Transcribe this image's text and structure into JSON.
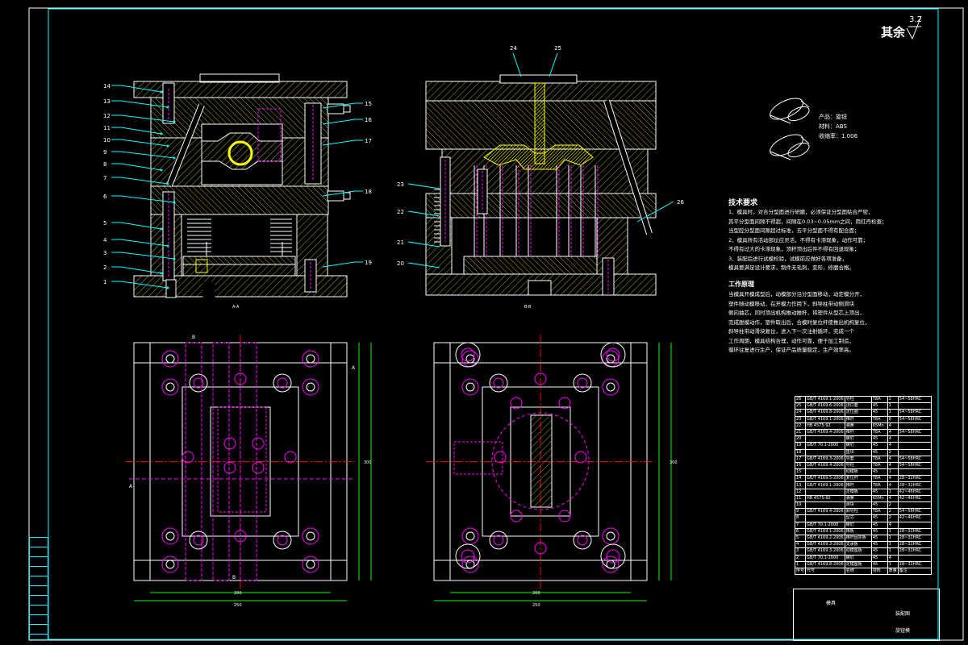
{
  "roughness": {
    "label": "其余",
    "value": "3.2"
  },
  "product": {
    "name": "产品：旋钮",
    "material": "材料：ABS",
    "shrink": "收缩率：1.006"
  },
  "tech": {
    "title": "技术要求",
    "lines": [
      "1、模具时，对合分型面进行研磨，必须保证分型面贴合严密，",
      "   其平分型面间隙不得超，间隙在0.03~0.05mm之间，用红丹检查；",
      "   当型腔分型面间隙超过标准，去平分型面不得有配合面；",
      "2、模具所有活动部位应灵活，不得有卡滞现象，动作可靠；",
      "   不得有过大的卡滞现象，顶杆顶出后件不得有回退现象；",
      "3、装配后进行试模检验，试模前应做好各项准备，",
      "   模具要满足设计要求，制件无毛刺，变形，修磨合格。"
    ]
  },
  "work": {
    "title": "工作原理",
    "lines": [
      "当模具开模成型后，动模部分沿分型面移动，动定模分开，",
      "塑件随动模移动，在开模力作用下，斜导柱带动侧滑块",
      "侧向抽芯，同时顶出机构推动推杆，将塑件从型芯上顶出，",
      "完成脱模动作，塑件取出后，合模时复位杆使推出机构复位，",
      "斜导柱带动滑块复位，进入下一次注射循环，完成一个",
      "工作周期，模具结构合理，动作可靠，便于加工制造，",
      "循环往复进行生产，保证产品质量稳定，生产效率高。"
    ]
  },
  "views": {
    "left": "A-A",
    "right": "B-B"
  },
  "balloons": {
    "left": [
      "14",
      "13",
      "12",
      "11",
      "10",
      "9",
      "8",
      "7",
      "6",
      "5",
      "4",
      "3",
      "2",
      "1"
    ],
    "leftRight": [
      "15",
      "16",
      "17",
      "18",
      "19"
    ],
    "rightTop": [
      "24",
      "25"
    ],
    "rightLeft": [
      "23",
      "22",
      "21",
      "20"
    ],
    "rightRight": [
      "26"
    ]
  },
  "bom": [
    [
      "26",
      "GB/T 4169.1-2006",
      "导柱",
      "T8A",
      "2",
      "54~58HRC"
    ],
    [
      "25",
      "GB/T 4169.6-2006",
      "浇口套",
      "45",
      "1",
      ""
    ],
    [
      "24",
      "GB/T 4169.8-2006",
      "定位圈",
      "45",
      "1",
      "54~58HRC"
    ],
    [
      "23",
      "GB/T 4169.1-2006",
      "推杆",
      "T8A",
      "8",
      "54~58HRC"
    ],
    [
      "22",
      "HB 4575-92",
      "弹簧",
      "65Mn",
      "4",
      ""
    ],
    [
      "21",
      "GB/T 4169.4-2006",
      "推杆",
      "T8A",
      "4",
      "54~58HRC"
    ],
    [
      "20",
      "",
      "螺钉",
      "45",
      "4",
      ""
    ],
    [
      "19",
      "GB/T 70.1-2000",
      "螺钉",
      "45",
      "4",
      ""
    ],
    [
      "18",
      "",
      "垫块",
      "45",
      "2",
      ""
    ],
    [
      "17",
      "GB/T 4169.3-2006",
      "导套",
      "T8A",
      "4",
      "54~58HRC"
    ],
    [
      "16",
      "GB/T 4169.4-2006",
      "导柱",
      "T8A",
      "4",
      "54~58HRC"
    ],
    [
      "15",
      "",
      "动模板",
      "45",
      "1",
      ""
    ],
    [
      "14",
      "GB/T 4169.5-2006",
      "复位杆",
      "T8A",
      "4",
      "28~32HRC"
    ],
    [
      "13",
      "GB/T 4169.1-2006",
      "推杆",
      "T8A",
      "4",
      "28~32HRC"
    ],
    [
      "12",
      "",
      "定模板",
      "45",
      "1",
      "42~46HRC"
    ],
    [
      "11",
      "HB 4575-92",
      "弹簧",
      "65Mn",
      "4",
      "42~46HRC"
    ],
    [
      "10",
      "",
      "滑块",
      "45",
      "2",
      ""
    ],
    [
      "9",
      "GB/T 4169.4-2006",
      "斜导柱",
      "T8A",
      "2",
      "54~58HRC"
    ],
    [
      "8",
      "",
      "型芯",
      "45",
      "2",
      "42~46HRC"
    ],
    [
      "7",
      "GB/T 70.1-2000",
      "螺钉",
      "45",
      "4",
      ""
    ],
    [
      "6",
      "GB/T 4169.1-2006",
      "推板",
      "45",
      "1",
      "28~32HRC"
    ],
    [
      "5",
      "GB/T 4169.2-2006",
      "推杆固定板",
      "45",
      "1",
      "28~32HRC"
    ],
    [
      "4",
      "GB/T 4169.3-2006",
      "支承板",
      "45",
      "1",
      "28~32HRC"
    ],
    [
      "3",
      "GB/T 4169.3-2006",
      "动模座板",
      "45",
      "1",
      "28~32HRC"
    ],
    [
      "2",
      "GB/T 70.1-2000",
      "螺钉",
      "45",
      "4",
      ""
    ],
    [
      "1",
      "GB/T 4169.8-2006",
      "定模座板",
      "45",
      "1",
      "28~32HRC"
    ]
  ],
  "bomHeader": [
    "序号",
    "代号",
    "名称",
    "材料",
    "数量",
    "备注"
  ],
  "titleBlock": {
    "company": "模具",
    "name": "旋钮模",
    "drawing": "装配图",
    "scale": "1:1"
  },
  "dims": {
    "leftW": "250",
    "leftW2": "200",
    "rightW": "250",
    "rightW2": "200",
    "h": "300",
    "h2": "250"
  }
}
